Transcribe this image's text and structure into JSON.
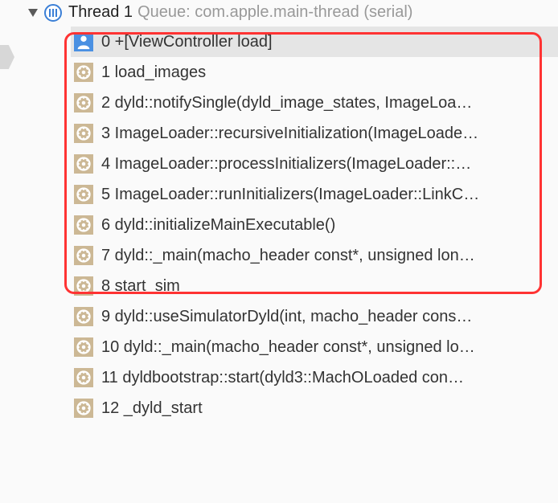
{
  "thread": {
    "title": "Thread 1",
    "queue": "Queue: com.apple.main-thread (serial)"
  },
  "frames": [
    {
      "index": 0,
      "name": "+[ViewController load]",
      "iconType": "user",
      "selected": true
    },
    {
      "index": 1,
      "name": "load_images",
      "iconType": "system",
      "selected": false
    },
    {
      "index": 2,
      "name": "dyld::notifySingle(dyld_image_states, ImageLoa…",
      "iconType": "system",
      "selected": false
    },
    {
      "index": 3,
      "name": "ImageLoader::recursiveInitialization(ImageLoade…",
      "iconType": "system",
      "selected": false
    },
    {
      "index": 4,
      "name": "ImageLoader::processInitializers(ImageLoader::…",
      "iconType": "system",
      "selected": false
    },
    {
      "index": 5,
      "name": "ImageLoader::runInitializers(ImageLoader::LinkC…",
      "iconType": "system",
      "selected": false
    },
    {
      "index": 6,
      "name": "dyld::initializeMainExecutable()",
      "iconType": "system",
      "selected": false
    },
    {
      "index": 7,
      "name": "dyld::_main(macho_header const*, unsigned lon…",
      "iconType": "system",
      "selected": false
    },
    {
      "index": 8,
      "name": "start_sim",
      "iconType": "system",
      "selected": false
    },
    {
      "index": 9,
      "name": "dyld::useSimulatorDyld(int, macho_header cons…",
      "iconType": "system",
      "selected": false
    },
    {
      "index": 10,
      "name": "dyld::_main(macho_header const*, unsigned lo…",
      "iconType": "system",
      "selected": false
    },
    {
      "index": 11,
      "name": "dyldbootstrap::start(dyld3::MachOLoaded con…",
      "iconType": "system",
      "selected": false
    },
    {
      "index": 12,
      "name": "_dyld_start",
      "iconType": "system",
      "selected": false
    }
  ]
}
